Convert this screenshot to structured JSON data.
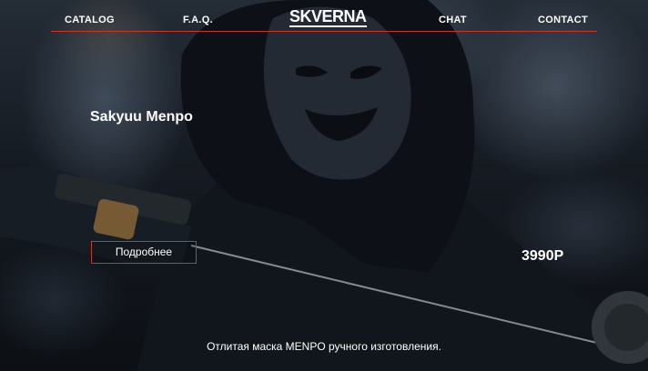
{
  "nav": {
    "catalog": "CATALOG",
    "faq": "F.A.Q.",
    "logo": "SKVERNA",
    "chat": "CHAT",
    "contact": "CONTACT"
  },
  "product": {
    "title": "Sakyuu Menpo",
    "button_label": "Подробнее",
    "price": "3990Р",
    "description": "Отлитая маска MENPO ручного изготовления."
  },
  "colors": {
    "accent": "#c0392b",
    "text": "#ffffff",
    "background": "#1a2029"
  }
}
